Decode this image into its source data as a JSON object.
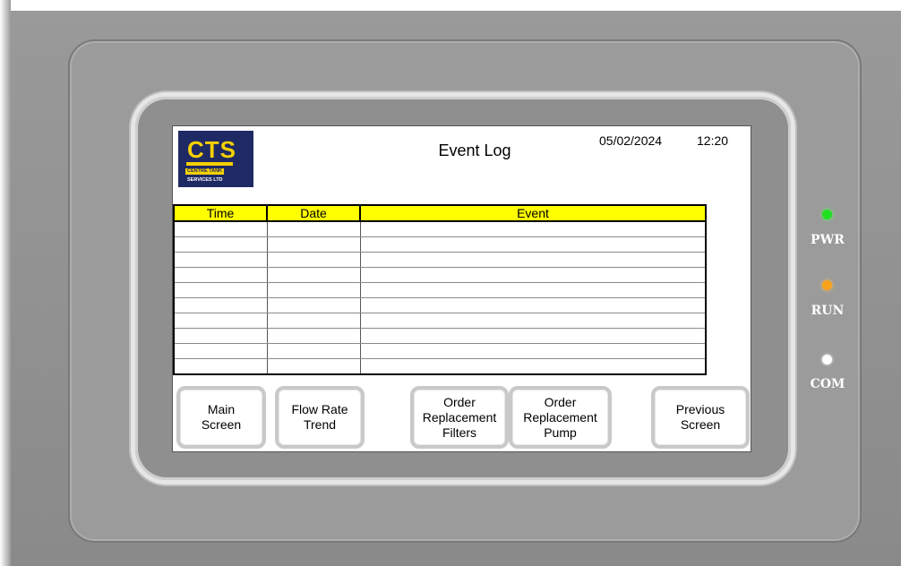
{
  "logo": {
    "main_text": "CTS",
    "line1": "CENTRE TANK",
    "line2": "SERVICES LTD"
  },
  "header": {
    "title": "Event Log",
    "date": "05/02/2024",
    "time": "12:20"
  },
  "table": {
    "columns": [
      "Time",
      "Date",
      "Event"
    ],
    "rows": [
      [
        "",
        "",
        ""
      ],
      [
        "",
        "",
        ""
      ],
      [
        "",
        "",
        ""
      ],
      [
        "",
        "",
        ""
      ],
      [
        "",
        "",
        ""
      ],
      [
        "",
        "",
        ""
      ],
      [
        "",
        "",
        ""
      ],
      [
        "",
        "",
        ""
      ],
      [
        "",
        "",
        ""
      ],
      [
        "",
        "",
        ""
      ]
    ],
    "header_color": "#ffff00"
  },
  "buttons": {
    "main_screen": "Main\nScreen",
    "flow_rate_trend": "Flow Rate\nTrend",
    "order_filters": "Order\nReplacement\nFilters",
    "order_pump": "Order\nReplacement\nPump",
    "previous_screen": "Previous\nScreen"
  },
  "indicators": {
    "pwr": {
      "label": "PWR",
      "color": "#21e021"
    },
    "run": {
      "label": "RUN",
      "color": "#f7a21b"
    },
    "com": {
      "label": "COM",
      "color": "#ffffff"
    }
  }
}
